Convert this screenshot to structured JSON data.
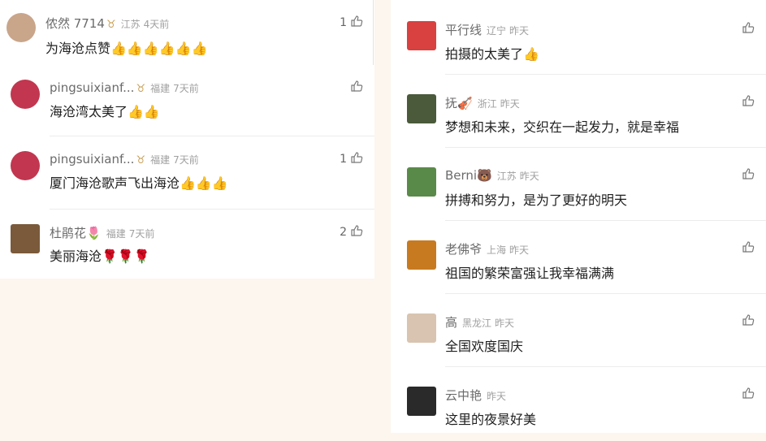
{
  "left": [
    {
      "name": "侬然 7714",
      "badge": "♉",
      "location": "江苏",
      "time": "4天前",
      "text": "为海沧点赞👍👍👍👍👍👍",
      "likes": "1",
      "avatar_color": "#c9a58a"
    },
    {
      "name": "pingsuixianf...",
      "badge": "♉",
      "location": "福建",
      "time": "7天前",
      "text": "海沧湾太美了👍👍",
      "likes": "",
      "avatar_color": "#c2364f"
    },
    {
      "name": "pingsuixianf...",
      "badge": "♉",
      "location": "福建",
      "time": "7天前",
      "text": "厦门海沧歌声飞出海沧👍👍👍",
      "likes": "1",
      "avatar_color": "#c2364f"
    },
    {
      "name": "杜鹃花🌷",
      "badge": "",
      "location": "福建",
      "time": "7天前",
      "text": "美丽海沧🌹🌹🌹",
      "likes": "2",
      "avatar_color": "#7a5a3a"
    }
  ],
  "right": [
    {
      "name": "平行线",
      "badge": "",
      "location": "辽宁",
      "time": "昨天",
      "text": "拍摄的太美了👍",
      "likes": "",
      "avatar_color": "#d94040"
    },
    {
      "name": "抚🎻",
      "badge": "",
      "location": "浙江",
      "time": "昨天",
      "text": "梦想和未来，交织在一起发力，就是幸福",
      "likes": "",
      "avatar_color": "#4a5a3a"
    },
    {
      "name": "Berni🐻",
      "badge": "",
      "location": "江苏",
      "time": "昨天",
      "text": "拼搏和努力，是为了更好的明天",
      "likes": "",
      "avatar_color": "#5a8a4a"
    },
    {
      "name": "老佛爷",
      "badge": "",
      "location": "上海",
      "time": "昨天",
      "text": "祖国的繁荣富强让我幸福满满",
      "likes": "",
      "avatar_color": "#c87a20"
    },
    {
      "name": "高",
      "badge": "",
      "location": "黑龙江",
      "time": "昨天",
      "text": "全国欢度国庆",
      "likes": "",
      "avatar_color": "#d8c4b0"
    },
    {
      "name": "云中艳",
      "badge": "",
      "location": "",
      "time": "昨天",
      "text": "这里的夜景好美",
      "likes": "",
      "avatar_color": "#2a2a2a"
    }
  ]
}
